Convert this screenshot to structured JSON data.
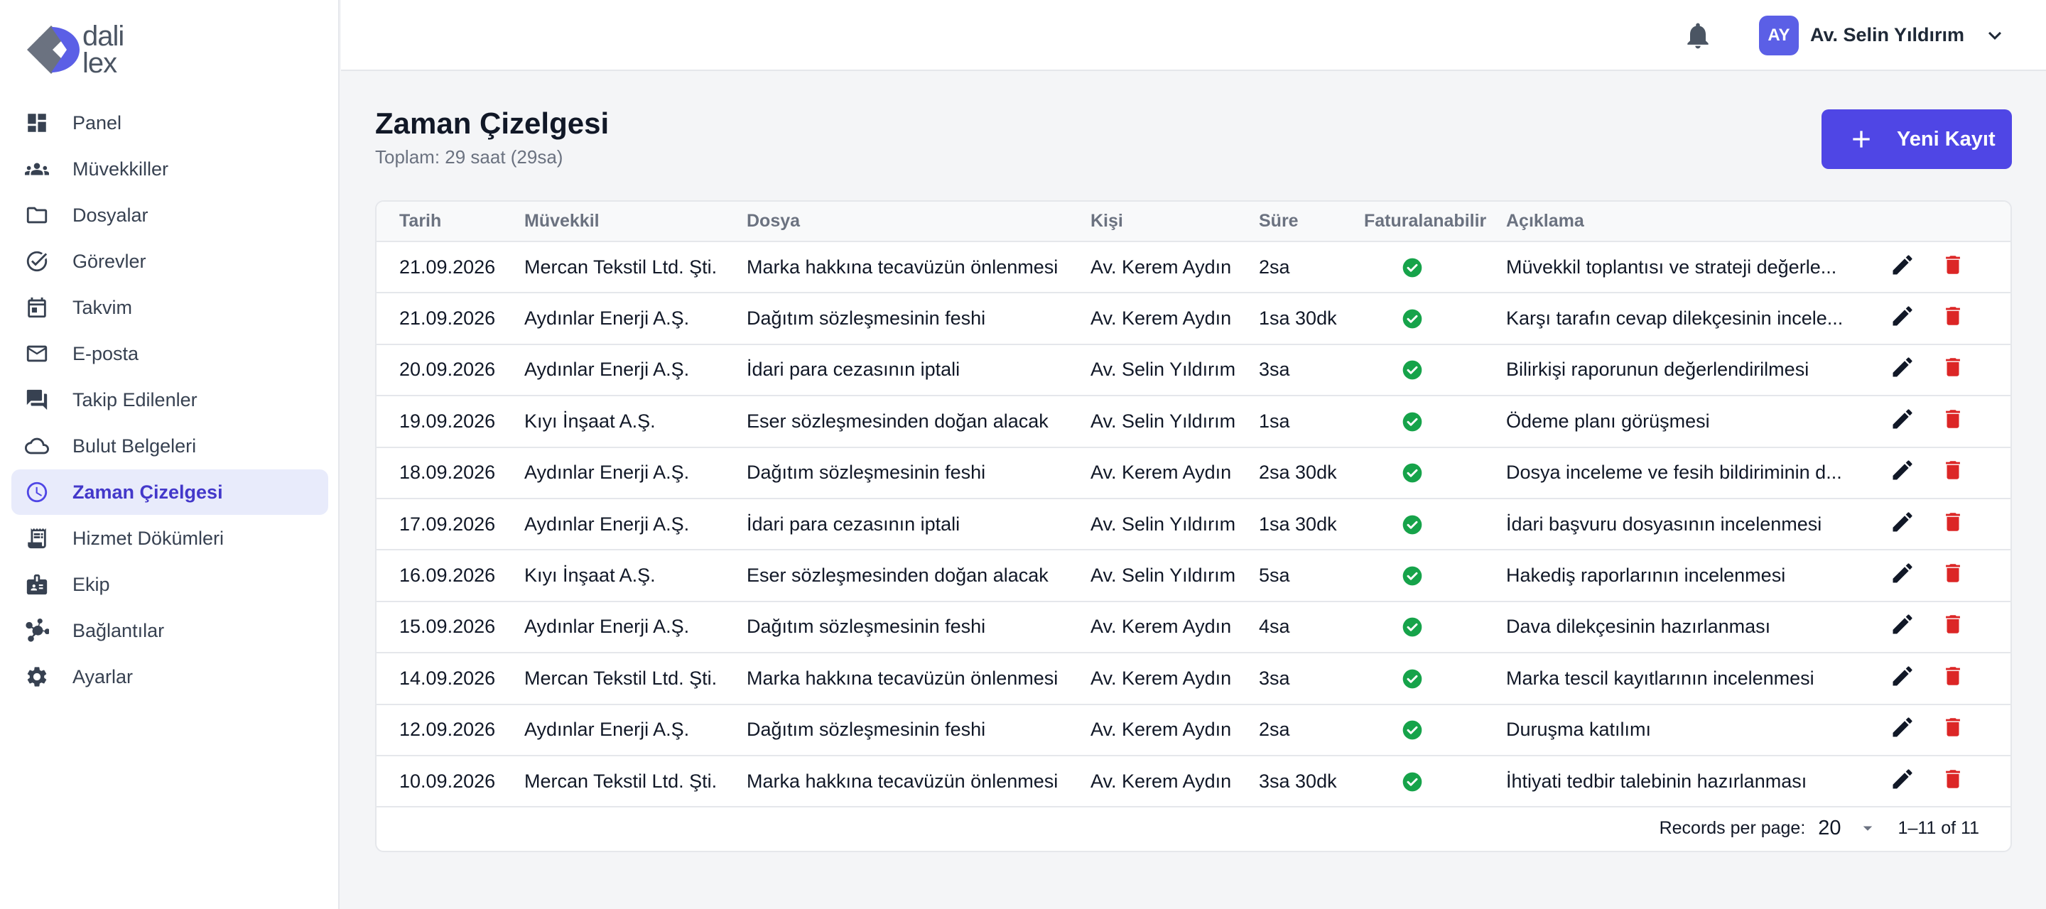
{
  "brand": {
    "logo_line1": "dali",
    "logo_line2": "lex"
  },
  "sidebar": {
    "items": [
      {
        "label": "Panel",
        "icon": "dashboard-icon"
      },
      {
        "label": "Müvekkiller",
        "icon": "groups-icon"
      },
      {
        "label": "Dosyalar",
        "icon": "folder-icon"
      },
      {
        "label": "Görevler",
        "icon": "task-check-icon"
      },
      {
        "label": "Takvim",
        "icon": "calendar-icon"
      },
      {
        "label": "E-posta",
        "icon": "mail-icon"
      },
      {
        "label": "Takip Edilenler",
        "icon": "forum-icon"
      },
      {
        "label": "Bulut Belgeleri",
        "icon": "cloud-icon"
      },
      {
        "label": "Zaman Çizelgesi",
        "icon": "clock-icon",
        "active": true
      },
      {
        "label": "Hizmet Dökümleri",
        "icon": "receipt-icon"
      },
      {
        "label": "Ekip",
        "icon": "badge-icon"
      },
      {
        "label": "Bağlantılar",
        "icon": "hub-icon"
      },
      {
        "label": "Ayarlar",
        "icon": "gear-icon"
      }
    ]
  },
  "topbar": {
    "avatar_initials": "AY",
    "user_name": "Av. Selin Yıldırım"
  },
  "page": {
    "title": "Zaman Çizelgesi",
    "subtitle": "Toplam: 29 saat (29sa)",
    "new_button_label": "Yeni Kayıt"
  },
  "table": {
    "headers": {
      "date": "Tarih",
      "client": "Müvekkil",
      "file": "Dosya",
      "person": "Kişi",
      "duration": "Süre",
      "billable": "Faturalanabilir",
      "description": "Açıklama"
    },
    "rows": [
      {
        "date": "21.09.2026",
        "client": "Mercan Tekstil Ltd. Şti.",
        "file": "Marka hakkına tecavüzün önlenmesi",
        "person": "Av. Kerem Aydın",
        "duration": "2sa",
        "description": "Müvekkil toplantısı ve strateji değerle..."
      },
      {
        "date": "21.09.2026",
        "client": "Aydınlar Enerji A.Ş.",
        "file": "Dağıtım sözleşmesinin feshi",
        "person": "Av. Kerem Aydın",
        "duration": "1sa 30dk",
        "description": "Karşı tarafın cevap dilekçesinin incele..."
      },
      {
        "date": "20.09.2026",
        "client": "Aydınlar Enerji A.Ş.",
        "file": "İdari para cezasının iptali",
        "person": "Av. Selin Yıldırım",
        "duration": "3sa",
        "description": "Bilirkişi raporunun değerlendirilmesi"
      },
      {
        "date": "19.09.2026",
        "client": "Kıyı İnşaat A.Ş.",
        "file": "Eser sözleşmesinden doğan alacak",
        "person": "Av. Selin Yıldırım",
        "duration": "1sa",
        "description": "Ödeme planı görüşmesi"
      },
      {
        "date": "18.09.2026",
        "client": "Aydınlar Enerji A.Ş.",
        "file": "Dağıtım sözleşmesinin feshi",
        "person": "Av. Kerem Aydın",
        "duration": "2sa 30dk",
        "description": "Dosya inceleme ve fesih bildiriminin d..."
      },
      {
        "date": "17.09.2026",
        "client": "Aydınlar Enerji A.Ş.",
        "file": "İdari para cezasının iptali",
        "person": "Av. Selin Yıldırım",
        "duration": "1sa 30dk",
        "description": "İdari başvuru dosyasının incelenmesi"
      },
      {
        "date": "16.09.2026",
        "client": "Kıyı İnşaat A.Ş.",
        "file": "Eser sözleşmesinden doğan alacak",
        "person": "Av. Selin Yıldırım",
        "duration": "5sa",
        "description": "Hakediş raporlarının incelenmesi"
      },
      {
        "date": "15.09.2026",
        "client": "Aydınlar Enerji A.Ş.",
        "file": "Dağıtım sözleşmesinin feshi",
        "person": "Av. Kerem Aydın",
        "duration": "4sa",
        "description": "Dava dilekçesinin hazırlanması"
      },
      {
        "date": "14.09.2026",
        "client": "Mercan Tekstil Ltd. Şti.",
        "file": "Marka hakkına tecavüzün önlenmesi",
        "person": "Av. Kerem Aydın",
        "duration": "3sa",
        "description": "Marka tescil kayıtlarının incelenmesi"
      },
      {
        "date": "12.09.2026",
        "client": "Aydınlar Enerji A.Ş.",
        "file": "Dağıtım sözleşmesinin feshi",
        "person": "Av. Kerem Aydın",
        "duration": "2sa",
        "description": "Duruşma katılımı"
      },
      {
        "date": "10.09.2026",
        "client": "Mercan Tekstil Ltd. Şti.",
        "file": "Marka hakkına tecavüzün önlenmesi",
        "person": "Av. Kerem Aydın",
        "duration": "3sa 30dk",
        "description": "İhtiyati tedbir talebinin hazırlanması"
      }
    ]
  },
  "pagination": {
    "records_per_page_label": "Records per page:",
    "records_per_page_value": "20",
    "range_text": "1–11 of 11"
  },
  "colors": {
    "accent": "#4f46e5",
    "active_nav_bg": "#e8ebfb",
    "billable_check": "#16a34a",
    "delete": "#dc2626"
  }
}
